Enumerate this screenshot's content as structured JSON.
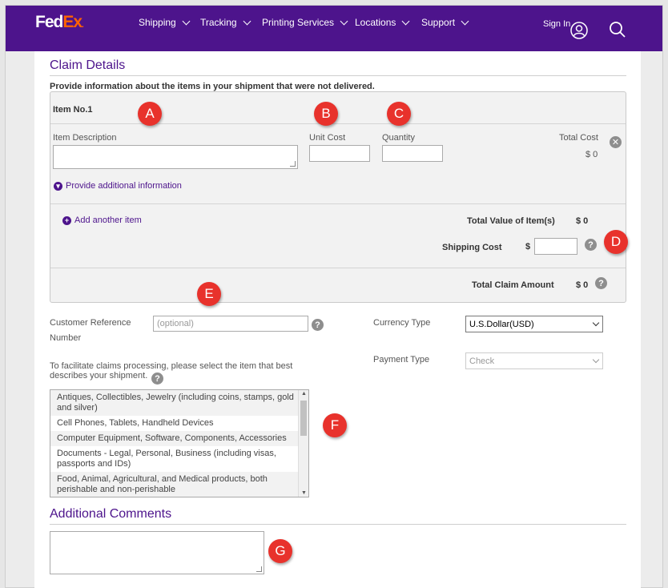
{
  "header": {
    "logo_fed": "Fed",
    "logo_ex": "Ex",
    "logo_dot": ".",
    "nav": [
      {
        "label": "Shipping"
      },
      {
        "label": "Tracking"
      },
      {
        "label": "Printing Services"
      },
      {
        "label": "Locations"
      },
      {
        "label": "Support"
      }
    ],
    "sign_in": "Sign In"
  },
  "claim": {
    "title": "Claim Details",
    "intro": "Provide information about the items in your shipment that were not delivered.",
    "item_no": "Item No.1",
    "item_description_label": "Item Description",
    "unit_cost_label": "Unit Cost",
    "quantity_label": "Quantity",
    "total_cost_label": "Total Cost",
    "total_cost_value": "$ 0",
    "additional_info": "Provide additional information",
    "add_item": "Add another item",
    "total_value_label": "Total Value of Item(s)",
    "total_value": "$ 0",
    "shipping_cost_label": "Shipping Cost",
    "shipping_currency": "$",
    "total_claim_label": "Total Claim Amount",
    "total_claim_value": "$ 0"
  },
  "reference": {
    "label_line1": "Customer Reference",
    "label_line2": "Number",
    "placeholder": "(optional)"
  },
  "currency": {
    "label": "Currency Type",
    "selected": "U.S.Dollar(USD)"
  },
  "payment": {
    "label": "Payment Type",
    "selected": "Check"
  },
  "category": {
    "prompt_line1": "To facilitate claims processing, please select the item that best",
    "prompt_line2": "describes your shipment.",
    "options": [
      "Antiques, Collectibles, Jewelry (including coins, stamps, gold and silver)",
      "Cell Phones, Tablets, Handheld Devices",
      "Computer Equipment, Software, Components, Accessories",
      "Documents - Legal, Personal, Business (including visas, passports and IDs)",
      "Food, Animal, Agricultural, and Medical products, both perishable and non-perishable"
    ]
  },
  "comments": {
    "title": "Additional Comments"
  },
  "markers": [
    "A",
    "B",
    "C",
    "D",
    "E",
    "F",
    "G"
  ],
  "colors": {
    "brand_purple": "#4d148c",
    "brand_orange": "#ff6200",
    "marker_red": "#e8322c"
  }
}
